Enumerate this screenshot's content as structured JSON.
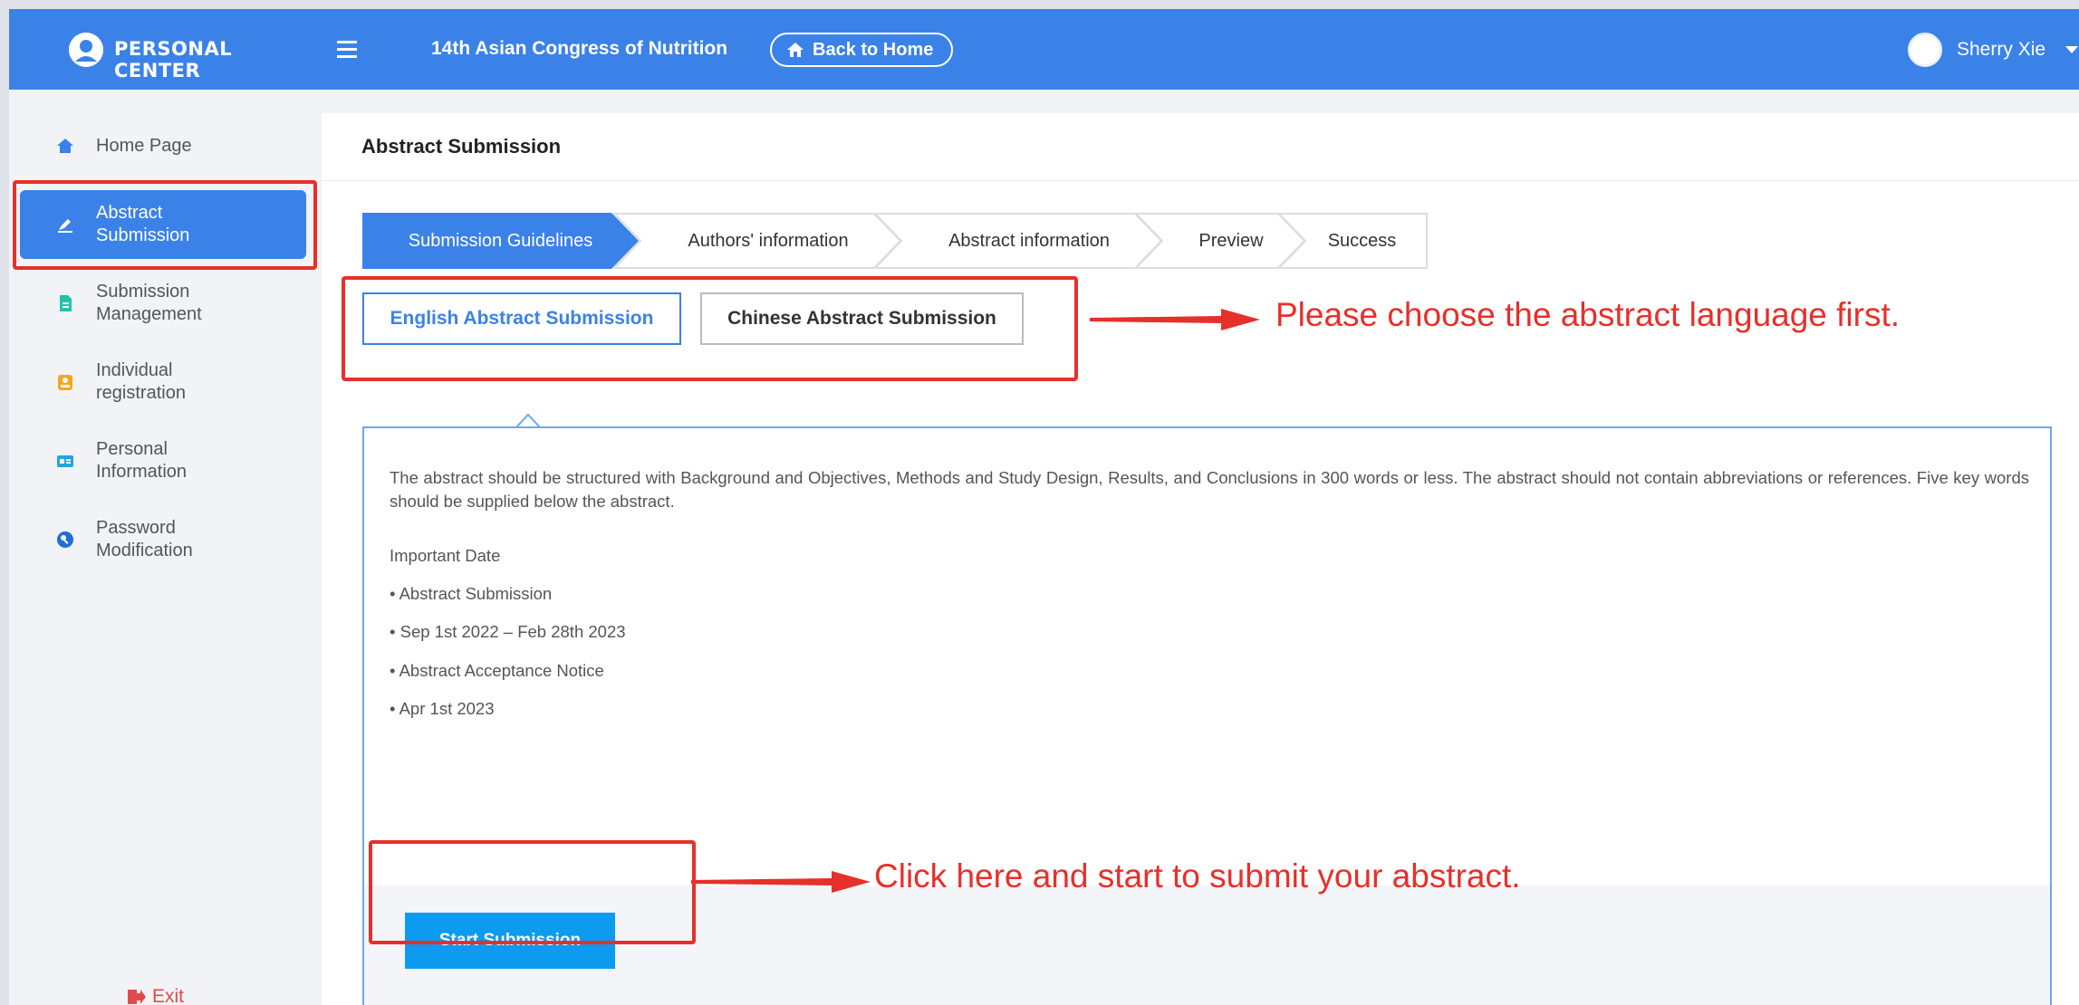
{
  "header": {
    "brand": "PERSONAL CENTER",
    "conference_title": "14th Asian Congress of Nutrition",
    "back_home_label": "Back to Home",
    "user_name": "Sherry Xie"
  },
  "sidebar": {
    "items": [
      {
        "label": "Home Page",
        "icon": "home-icon",
        "active": false
      },
      {
        "label": "Abstract\nSubmission",
        "icon": "edit-icon",
        "active": true
      },
      {
        "label": "Submission\nManagement",
        "icon": "document-icon",
        "active": false
      },
      {
        "label": "Individual\nregistration",
        "icon": "id-badge-icon",
        "active": false
      },
      {
        "label": "Personal\nInformation",
        "icon": "id-card-icon",
        "active": false
      },
      {
        "label": "Password\nModification",
        "icon": "key-icon",
        "active": false
      }
    ],
    "exit_label": "Exit"
  },
  "main": {
    "breadcrumb": "Abstract Submission",
    "steps": [
      {
        "label": "Submission Guidelines",
        "active": true
      },
      {
        "label": "Authors' information",
        "active": false
      },
      {
        "label": "Abstract information",
        "active": false
      },
      {
        "label": "Preview",
        "active": false
      },
      {
        "label": "Success",
        "active": false
      }
    ],
    "language_tabs": [
      {
        "label": "English Abstract Submission",
        "active": true
      },
      {
        "label": "Chinese Abstract Submission",
        "active": false
      }
    ],
    "guidelines": {
      "paragraph": "The abstract should be structured with Background and Objectives, Methods and Study Design, Results, and Conclusions in 300 words or less. The abstract should not contain abbreviations or references. Five key words should be supplied below the abstract.",
      "lines": [
        "Important Date",
        "• Abstract Submission",
        "• Sep 1st 2022 – Feb 28th 2023",
        "• Abstract Acceptance Notice",
        "• Apr 1st 2023"
      ]
    },
    "start_button": "Start Submission"
  },
  "annotations": {
    "language_note": "Please choose the abstract language first.",
    "start_note": "Click here and start to submit your abstract.",
    "color": "#e6302a"
  },
  "colors": {
    "primary": "#3b82e8",
    "start_button": "#0c9bef",
    "exit": "#e24a4a"
  }
}
